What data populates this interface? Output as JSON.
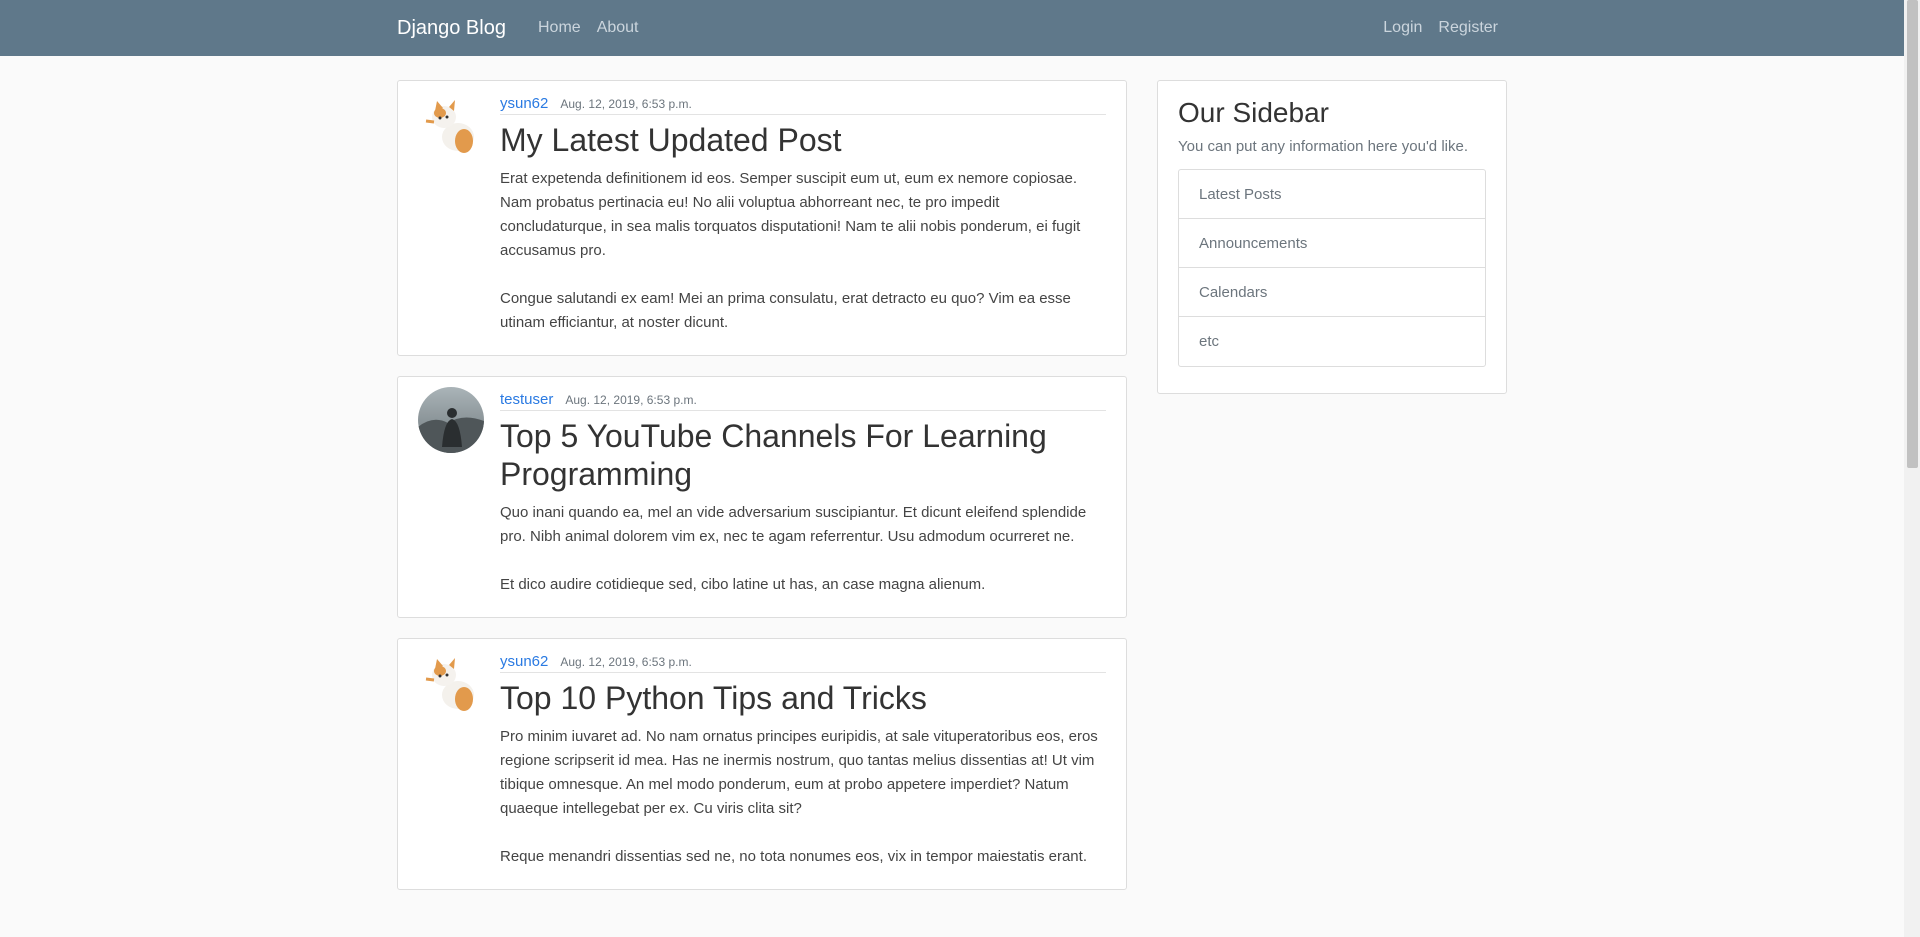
{
  "navbar": {
    "brand": "Django Blog",
    "links": [
      "Home",
      "About"
    ],
    "right_links": [
      "Login",
      "Register"
    ]
  },
  "posts": [
    {
      "author": "ysun62",
      "date": "Aug. 12, 2019, 6:53 p.m.",
      "avatar": "cat-avatar",
      "title": "My Latest Updated Post",
      "content": "Erat expetenda definitionem id eos. Semper suscipit eum ut, eum ex nemore copiosae. Nam probatus pertinacia eu! No alii voluptua abhorreant nec, te pro impedit concludaturque, in sea malis torquatos disputationi! Nam te alii nobis ponderum, ei fugit accusamus pro.\n\nCongue salutandi ex eam! Mei an prima consulatu, erat detracto eu quo? Vim ea esse utinam efficiantur, at noster dicunt."
    },
    {
      "author": "testuser",
      "date": "Aug. 12, 2019, 6:53 p.m.",
      "avatar": "person-avatar",
      "title": "Top 5 YouTube Channels For Learning Programming",
      "content": "Quo inani quando ea, mel an vide adversarium suscipiantur. Et dicunt eleifend splendide pro. Nibh animal dolorem vim ex, nec te agam referrentur. Usu admodum ocurreret ne.\n\nEt dico audire cotidieque sed, cibo latine ut has, an case magna alienum."
    },
    {
      "author": "ysun62",
      "date": "Aug. 12, 2019, 6:53 p.m.",
      "avatar": "cat-avatar",
      "title": "Top 10 Python Tips and Tricks",
      "content": "Pro minim iuvaret ad. No nam ornatus principes euripidis, at sale vituperatoribus eos, eros regione scripserit id mea. Has ne inermis nostrum, quo tantas melius dissentias at! Ut vim tibique omnesque. An mel modo ponderum, eum at probo appetere imperdiet? Natum quaeque intellegebat per ex. Cu viris clita sit?\n\nReque menandri dissentias sed ne, no tota nonumes eos, vix in tempor maiestatis erant."
    }
  ],
  "sidebar": {
    "title": "Our Sidebar",
    "text": "You can put any information here you'd like.",
    "items": [
      "Latest Posts",
      "Announcements",
      "Calendars",
      "etc"
    ]
  },
  "colors": {
    "navbar": "#5f788a",
    "link": "#2a7ae2",
    "background": "#fafafa"
  }
}
